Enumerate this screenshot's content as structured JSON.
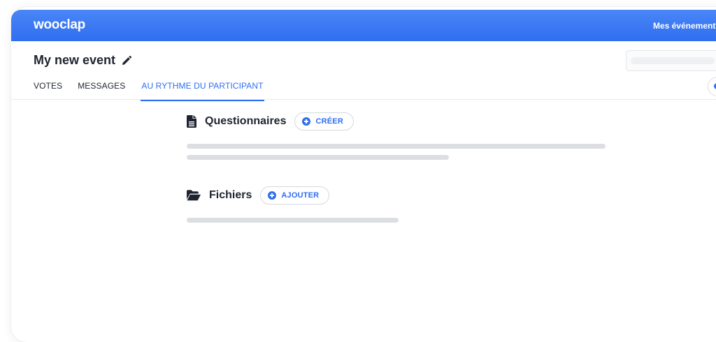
{
  "app": {
    "logo": "wooclap",
    "nav_link": "Mes événements"
  },
  "event": {
    "title": "My new event"
  },
  "tabs": [
    {
      "label": "VOTES",
      "active": false
    },
    {
      "label": "MESSAGES",
      "active": false
    },
    {
      "label": "AU RYTHME DU PARTICIPANT",
      "active": true
    }
  ],
  "sections": {
    "questionnaires": {
      "title": "Questionnaires",
      "button_label": "CRÉER",
      "icon": "document-icon"
    },
    "fichiers": {
      "title": "Fichiers",
      "button_label": "AJOUTER",
      "icon": "folder-open-icon"
    }
  },
  "colors": {
    "accent": "#2f6ef0",
    "navbar": "#3b7bf4",
    "text": "#1f2430",
    "placeholder": "#dcdee2"
  }
}
